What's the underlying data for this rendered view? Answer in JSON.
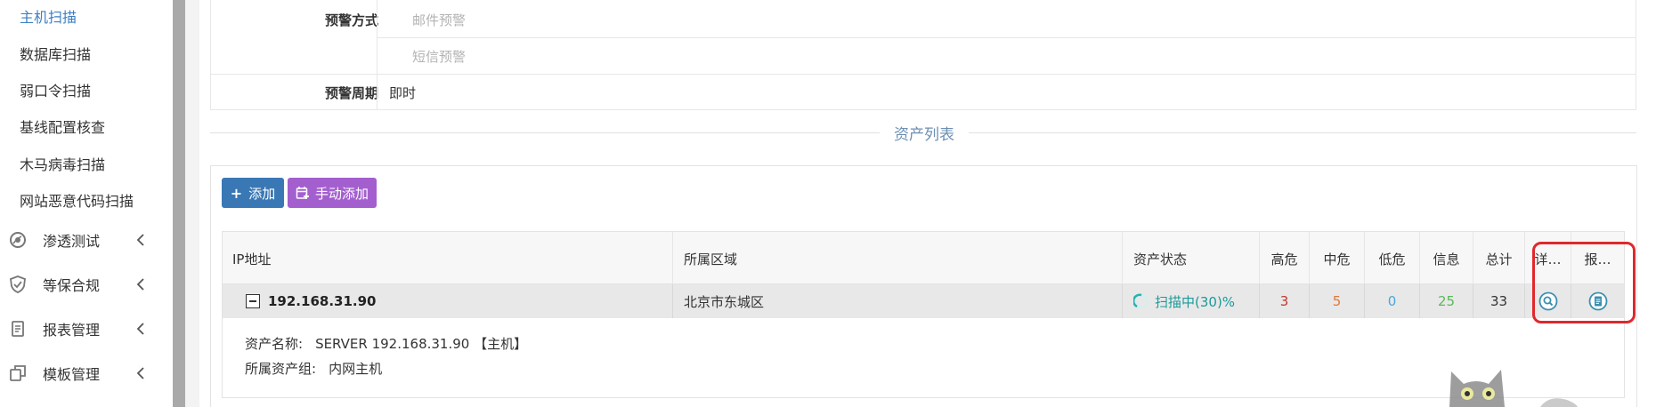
{
  "sidebar": {
    "subitems": [
      "主机扫描",
      "数据库扫描",
      "弱口令扫描",
      "基线配置核查",
      "木马病毒扫描",
      "网站恶意代码扫描"
    ],
    "active_index": 0,
    "groups": [
      {
        "label": "渗透测试",
        "icon": "compass-icon"
      },
      {
        "label": "等保合规",
        "icon": "shield-icon"
      },
      {
        "label": "报表管理",
        "icon": "report-icon"
      },
      {
        "label": "模板管理",
        "icon": "template-icon"
      }
    ]
  },
  "form": {
    "alert_method_label": "预警方式",
    "alert_email": "邮件预警",
    "alert_sms": "短信预警",
    "alert_period_label": "预警周期",
    "alert_period_value": "即时"
  },
  "section": {
    "title": "资产列表"
  },
  "toolbar": {
    "add_label": "添加",
    "manual_add_label": "手动添加"
  },
  "table": {
    "headers": {
      "ip": "IP地址",
      "region": "所属区域",
      "status": "资产状态",
      "high": "高危",
      "medium": "中危",
      "low": "低危",
      "info": "信息",
      "total": "总计",
      "detail": "详…",
      "report": "报…"
    },
    "rows": [
      {
        "ip": "192.168.31.90",
        "region": "北京市东城区",
        "status": "扫描中(30)%",
        "progress": 0.3,
        "high": "3",
        "medium": "5",
        "low": "0",
        "info": "25",
        "total": "33",
        "asset_name_label": "资产名称:",
        "asset_name": "SERVER 192.168.31.90 【主机】",
        "asset_group_label": "所属资产组:",
        "asset_group": "内网主机"
      }
    ]
  },
  "colors": {
    "accent": "#3c7fc4",
    "high": "#c0392b",
    "medium": "#e07a3a",
    "low": "#4aa8d8",
    "info": "#5cb85c",
    "status": "#1a9a9a",
    "highlight": "#e0282c"
  }
}
